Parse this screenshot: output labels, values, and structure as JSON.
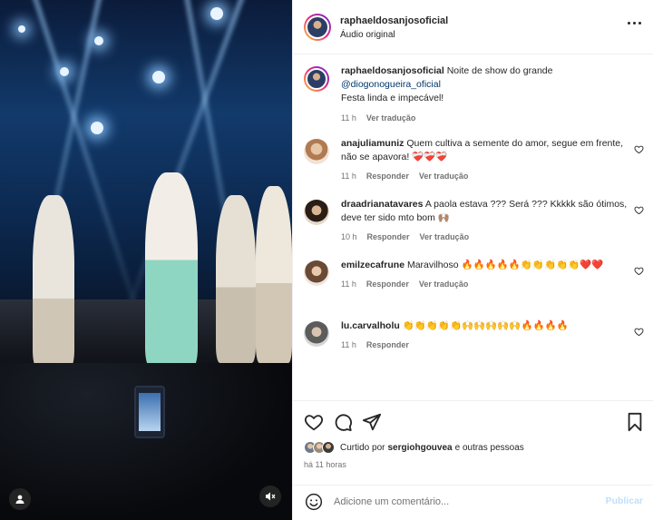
{
  "post": {
    "username": "raphaeldosanjosoficial",
    "audio": "Áudio original",
    "caption_prefix": "Noite de show do grande",
    "caption_mention": "@diogonogueira_oficial",
    "caption_line2": "Festa linda e impecável!",
    "caption_time": "11 h",
    "translate": "Ver tradução"
  },
  "comments": [
    {
      "user": "anajuliamuniz",
      "text": "Quem cultiva a semente do amor, segue em frente, não se apavora! ❤️‍🩹❤️‍🩹❤️‍🩹",
      "time": "11 h",
      "reply": "Responder",
      "translate": "Ver tradução"
    },
    {
      "user": "draadrianatavares",
      "text": "A paola estava ??? Será ??? Kkkkk são ótimos, deve ter sido mto bom 🙌🏽",
      "time": "10 h",
      "reply": "Responder",
      "translate": "Ver tradução"
    },
    {
      "user": "emilzecafrune",
      "text": "Maravilhoso 🔥🔥🔥🔥🔥👏👏👏👏👏❤️❤️",
      "time": "11 h",
      "reply": "Responder",
      "translate": "Ver tradução"
    },
    {
      "user": "lu.carvalholu",
      "text": "👏👏👏👏👏🙌🙌🙌🙌🙌🔥🔥🔥🔥",
      "time": "11 h",
      "reply": "Responder"
    }
  ],
  "likes": {
    "prefix": "Curtido por",
    "user": "sergiohgouvea",
    "suffix": "e outras pessoas"
  },
  "time_ago": "há 11 horas",
  "add_comment": {
    "placeholder": "Adicione um comentário...",
    "publish": "Publicar"
  },
  "icons": {
    "more": "more-options-icon",
    "heart": "heart-icon",
    "comment": "comment-icon",
    "share": "share-icon",
    "save": "bookmark-icon",
    "emoji": "emoji-icon",
    "mute": "muted-speaker-icon",
    "tagged": "tagged-user-icon"
  },
  "colors": {
    "text": "#262626",
    "muted": "#737373",
    "link": "#00376b",
    "publish_disabled": "#c0dffd"
  }
}
